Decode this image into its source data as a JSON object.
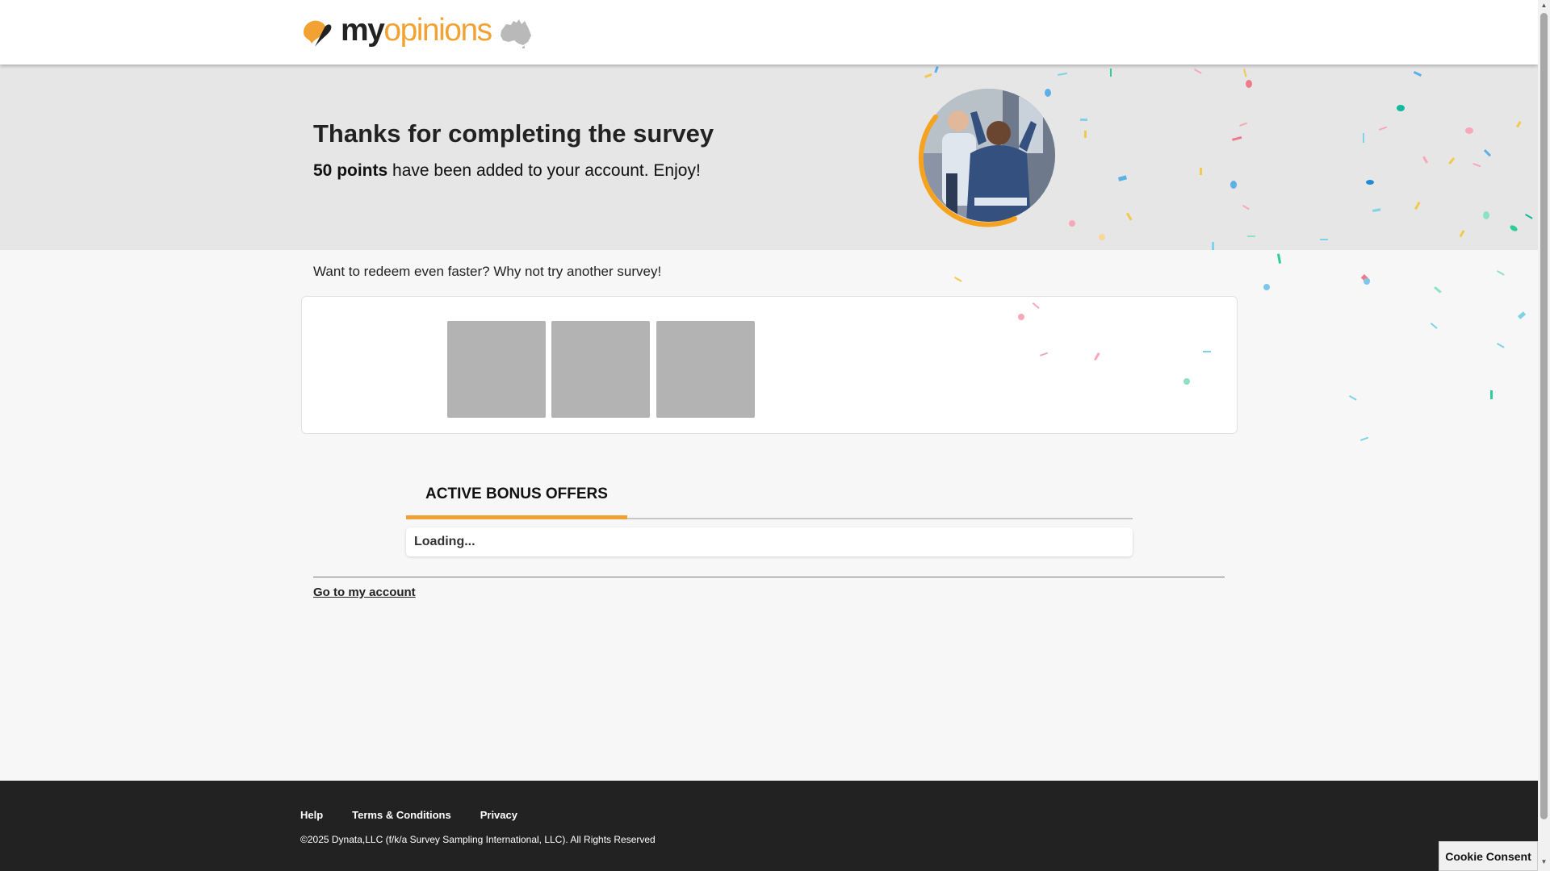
{
  "header": {
    "logo_my": "my",
    "logo_opinions": "opinions"
  },
  "hero": {
    "title": "Thanks for completing the survey",
    "points": "50 points",
    "message": " have been added to your account. Enjoy!"
  },
  "surveys": {
    "prompt": "Want to redeem even faster? Why not try another survey!",
    "tiles": 3
  },
  "bonus": {
    "tab_label": "ACTIVE BONUS OFFERS",
    "loading_text": "Loading..."
  },
  "account": {
    "link_label": "Go to my account"
  },
  "footer": {
    "links": [
      "Help",
      "Terms & Conditions",
      "Privacy"
    ],
    "copyright": "©2025 Dynata,LLC (f/k/a Survey Sampling International, LLC). All Rights Reserved",
    "cookie_label": "Cookie Consent"
  },
  "colors": {
    "brand_orange": "#f2a233",
    "footer_bg": "#222222",
    "hero_bg": "#e6e6e6"
  }
}
